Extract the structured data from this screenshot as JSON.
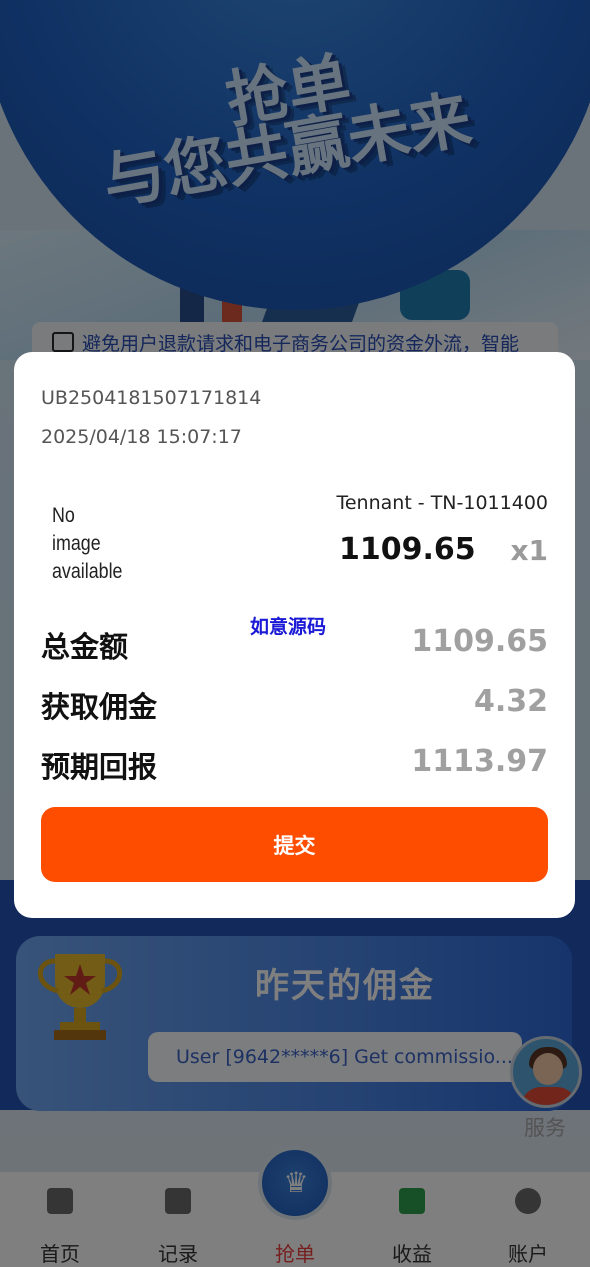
{
  "hero": {
    "title_line1": "抢单",
    "title_line2": "与您共赢未来"
  },
  "notice": {
    "icon": "speaker-icon",
    "text": "避免用户退款请求和电子商务公司的资金外流，智能"
  },
  "commission": {
    "title": "昨天的佣金",
    "ticker": "User [9642*****6] Get commissio..."
  },
  "service": {
    "label": "服务"
  },
  "tabbar": {
    "items": [
      {
        "label": "首页",
        "icon": "home-icon"
      },
      {
        "label": "记录",
        "icon": "clipboard-icon"
      },
      {
        "label": "抢单",
        "icon": "crown-icon"
      },
      {
        "label": "收益",
        "icon": "thumbs-up-icon"
      },
      {
        "label": "账户",
        "icon": "user-icon"
      }
    ],
    "active_color": "#ee3f3f"
  },
  "modal": {
    "order_no": "UB2504181507171814",
    "order_time": "2025/04/18 15:07:17",
    "product_image_text_line1": "No image",
    "product_image_text_line2": "available",
    "product_name": "Tennant - TN-1011400",
    "product_price": "1109.65",
    "product_qty": "x1",
    "watermark": "如意源码",
    "summary": [
      {
        "label": "总金额",
        "value": "1109.65"
      },
      {
        "label": "获取佣金",
        "value": "4.32"
      },
      {
        "label": "预期回报",
        "value": "1113.97"
      }
    ],
    "submit_label": "提交",
    "submit_color": "#ff4d00"
  }
}
